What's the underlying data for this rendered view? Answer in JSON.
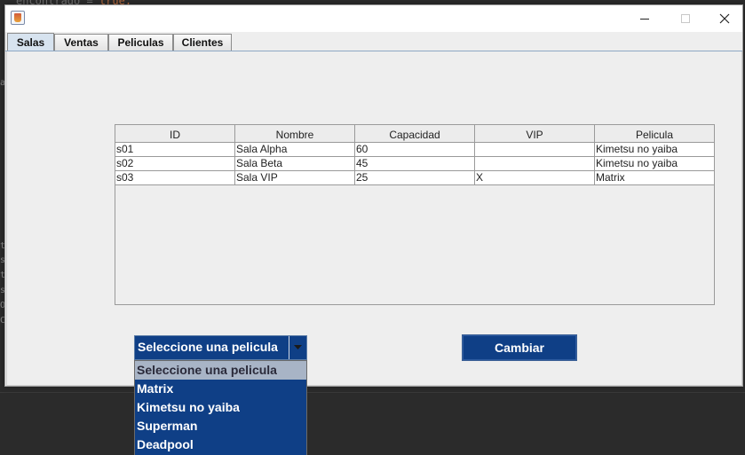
{
  "background": {
    "code_fragment": "encontrado = ",
    "code_keyword": "true;",
    "left_edge_chars": [
      "a",
      "t",
      "s",
      "t",
      "s",
      "O",
      "C"
    ]
  },
  "window": {
    "icon": "java-cup-icon",
    "controls": {
      "minimize": "minimize-icon",
      "maximize": "maximize-icon",
      "close": "close-icon"
    }
  },
  "tabs": [
    {
      "label": "Salas",
      "active": true
    },
    {
      "label": "Ventas",
      "active": false
    },
    {
      "label": "Peliculas",
      "active": false
    },
    {
      "label": "Clientes",
      "active": false
    }
  ],
  "table": {
    "columns": [
      "ID",
      "Nombre",
      "Capacidad",
      "VIP",
      "Pelicula"
    ],
    "rows": [
      [
        "s01",
        "Sala Alpha",
        "60",
        "",
        "Kimetsu no yaiba"
      ],
      [
        "s02",
        "Sala Beta",
        "45",
        "",
        "Kimetsu no yaiba"
      ],
      [
        "s03",
        "Sala VIP",
        "25",
        "X",
        "Matrix"
      ]
    ]
  },
  "combo": {
    "selected": "Seleccione una pelicula",
    "options": [
      "Seleccione una pelicula",
      "Matrix",
      "Kimetsu no yaiba",
      "Superman",
      "Deadpool"
    ]
  },
  "actions": {
    "change_label": "Cambiar"
  },
  "colors": {
    "accent": "#0f3f86",
    "selected_option": "#a8b4c6",
    "window_bg": "#eeeeee",
    "desktop_bg": "#2b2b2b"
  }
}
